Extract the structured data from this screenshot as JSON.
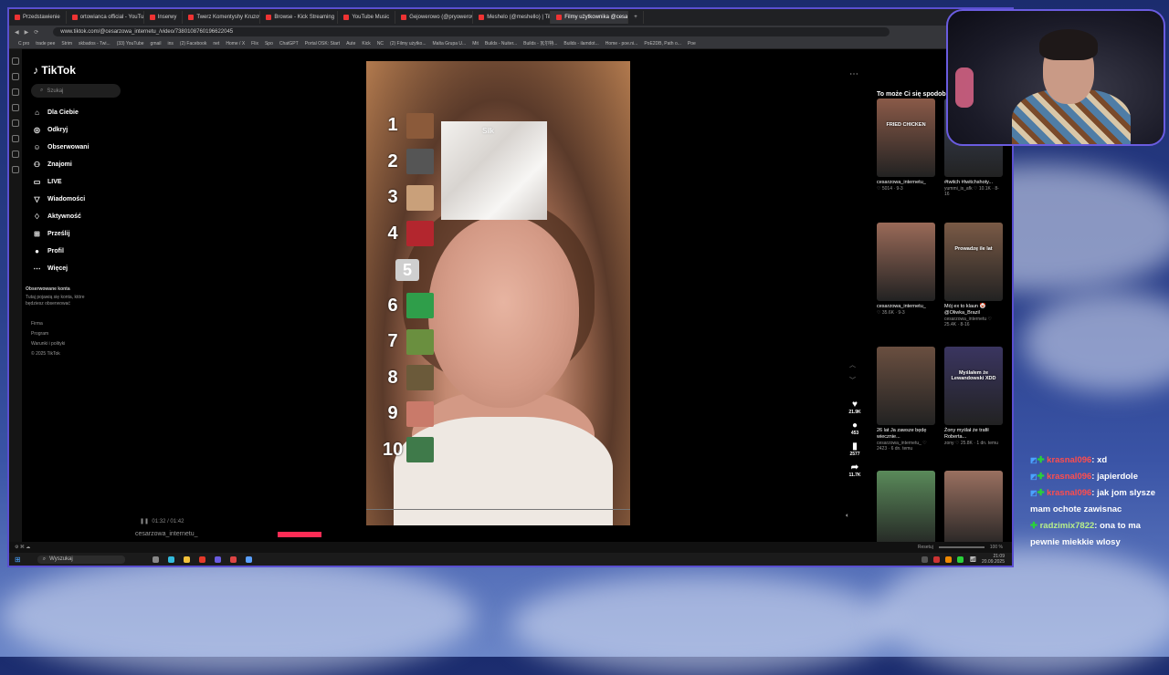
{
  "browser": {
    "tabs": [
      {
        "label": "Przedstawienie"
      },
      {
        "label": "ortowianca official - YouTube"
      },
      {
        "label": "Inserwy"
      },
      {
        "label": "Twerz Komentyshy Kruzowel"
      },
      {
        "label": "Browse - Kick Streaming"
      },
      {
        "label": "YouTube Music"
      },
      {
        "label": "Gejowerowo (@pryowerowo)"
      },
      {
        "label": "Meshelo (@meshello) | Tik"
      },
      {
        "label": "Filmy użytkownika @cesa"
      }
    ],
    "url": "www.tiktok.com/@cesarzowa_internetu_/video/7380108760196622045",
    "bookmarks": [
      "C pro",
      "trade pee",
      "Strim",
      "skbados - Twi...",
      "(33) YouTube",
      "gmail",
      "ins",
      "(2) Facebook",
      "net",
      "Home / X",
      "Flix",
      "Spo",
      "ChatGPT",
      "Portal OSK: Start",
      "Aute",
      "Kick",
      "NC",
      "(2) Filmy użytko...",
      "Malta Grupa U...",
      "Mit",
      "Builds - Nuiter...",
      "Builds - 瓦尔特...",
      "Builds - ilamdot...",
      "Home - poe.ni...",
      "PoE2DB, Path o...",
      "Poe"
    ]
  },
  "tiktok": {
    "logo": "TikTok",
    "search_placeholder": "Szukaj",
    "nav": [
      {
        "label": "Dla Ciebie",
        "icon": "home-icon"
      },
      {
        "label": "Odkryj",
        "icon": "compass-icon"
      },
      {
        "label": "Obserwowani",
        "icon": "following-icon"
      },
      {
        "label": "Znajomi",
        "icon": "friends-icon"
      },
      {
        "label": "LIVE",
        "icon": "live-icon"
      },
      {
        "label": "Wiadomości",
        "icon": "messages-icon"
      },
      {
        "label": "Aktywność",
        "icon": "activity-icon"
      },
      {
        "label": "Prześlij",
        "icon": "upload-icon"
      },
      {
        "label": "Profil",
        "icon": "profile-icon"
      },
      {
        "label": "Więcej",
        "icon": "more-icon"
      }
    ],
    "followed_title": "Obserwowane konta",
    "followed_desc": "Tutaj pojawią się konta, które będziesz obserwować",
    "footer": [
      "Firma",
      "Program",
      "Warunki i polityki",
      "© 2025 TikTok"
    ],
    "video": {
      "overlay_label": "Silk",
      "ranks": [
        "1",
        "2",
        "3",
        "4",
        "5",
        "6",
        "7",
        "8",
        "9",
        "10"
      ],
      "rank_colors": [
        "#8b5a3a",
        "#555555",
        "#c9a07a",
        "#b3262e",
        "#cfcfcf",
        "#2f9e4a",
        "#6a8f3f",
        "#6b5a3a",
        "#c97a6a",
        "#3f7a4a"
      ],
      "time": "01:32 / 01:42",
      "author": "cesarzowa_internetu_"
    },
    "actions": [
      {
        "icon": "heart-icon",
        "count": "21.9K"
      },
      {
        "icon": "comment-icon",
        "count": "453"
      },
      {
        "icon": "bookmark-icon",
        "count": "2577"
      },
      {
        "icon": "share-icon",
        "count": "11.7K"
      }
    ],
    "suggestions_title": "To może Ci się spodobać",
    "suggestions": [
      {
        "title": "cesarzowa_internetu_",
        "meta": "♡ 5014 · 9-3",
        "color": "#8a5a48",
        "overlay": "FRIED CHICKEN"
      },
      {
        "title": "#twitch #twitchshoty...",
        "meta": "yummi_is_afk  ♡ 10.1K · 8-16",
        "color": "#3a4358",
        "overlay": ""
      },
      {
        "title": "cesarzowa_internetu_",
        "meta": "♡ 35.6K · 9-3",
        "color": "#9a6a58",
        "overlay": ""
      },
      {
        "title": "Mój ex to klaun 🤡 @Oliwka_Brazil",
        "meta": "cesarzowa_internetu  ♡ 25.4K · 8-16",
        "color": "#7a5a46",
        "overlay": "Prowadzę ile lat"
      },
      {
        "title": "26 lat Ja zawsze będę wiecznie...",
        "meta": "cesarzowa_internetu_  ♡ 2423 · 6 dn. temu",
        "color": "#6a4f40",
        "overlay": ""
      },
      {
        "title": "Żony myślał że trafił Roberta...",
        "meta": "zony  ♡ 25.8K · 1 dn. temu",
        "color": "#3a3560",
        "overlay": "Myślałem że Lewandowski XDD"
      },
      {
        "title": "",
        "meta": "",
        "color": "#5a8a5a",
        "overlay": ""
      },
      {
        "title": "",
        "meta": "",
        "color": "#9a7060",
        "overlay": ""
      }
    ]
  },
  "taskbar": {
    "search": "Wyszukaj",
    "zoom": "100 %",
    "time": "21:09",
    "date": "20.09.2025",
    "reset": "Resetuj"
  },
  "chat": [
    {
      "user": "krasnal096",
      "msg": ": xd",
      "color": "red"
    },
    {
      "user": "krasnal096",
      "msg": ": japierdole",
      "color": "red"
    },
    {
      "user": "krasnal096",
      "msg": ": jak jom slysze mam ochote zawisnac",
      "color": "red"
    },
    {
      "user": "radzimix7822",
      "msg": ": ona to ma pewnie miekkie wlosy",
      "color": "green"
    }
  ]
}
